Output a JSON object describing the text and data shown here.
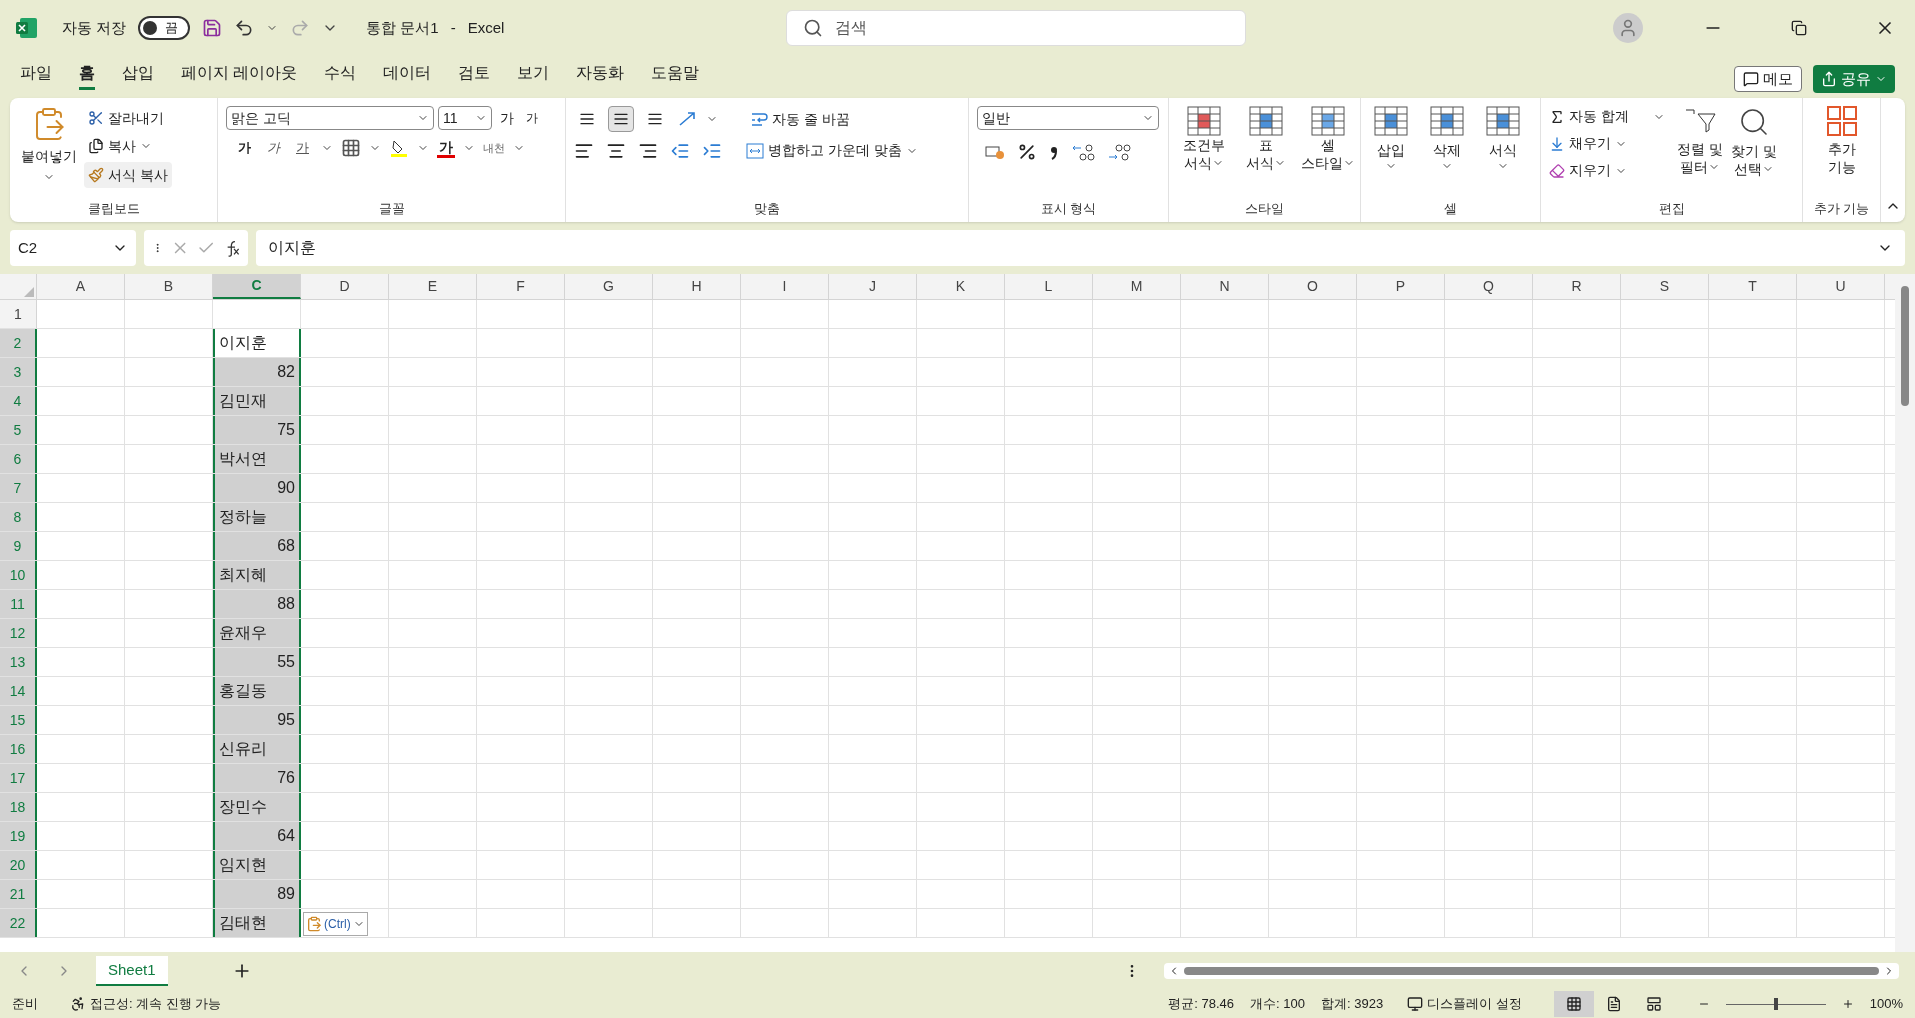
{
  "title_bar": {
    "autosave_label": "자동 저장",
    "autosave": {
      "label": "끔",
      "on": false
    },
    "document_title": "통합 문서1",
    "separator": "-",
    "app_name": "Excel",
    "search_placeholder": "검색"
  },
  "menu_tabs": [
    {
      "label": "파일",
      "selected": false
    },
    {
      "label": "홈",
      "selected": true
    },
    {
      "label": "삽입",
      "selected": false
    },
    {
      "label": "페이지 레이아웃",
      "selected": false
    },
    {
      "label": "수식",
      "selected": false
    },
    {
      "label": "데이터",
      "selected": false
    },
    {
      "label": "검토",
      "selected": false
    },
    {
      "label": "보기",
      "selected": false
    },
    {
      "label": "자동화",
      "selected": false
    },
    {
      "label": "도움말",
      "selected": false
    }
  ],
  "memo_button": "메모",
  "share_button": "공유",
  "ribbon": {
    "clipboard": {
      "label": "클립보드",
      "paste": "붙여넣기",
      "cut": "잘라내기",
      "copy": "복사",
      "format_painter": "서식 복사"
    },
    "font": {
      "label": "글꼴",
      "font_name": "맑은 고딕",
      "font_size": "11",
      "grow_font": "가",
      "shrink_font": "가",
      "bold": "가",
      "italic": "가",
      "underline": "가",
      "font_color": "가",
      "phonetic": "내천"
    },
    "alignment": {
      "label": "맞춤",
      "vertical_align": [
        {
          "selected": false
        },
        {
          "selected": true
        },
        {
          "selected": false
        }
      ],
      "wrap_text": "자동 줄 바꿈",
      "merge_center": "병합하고 가운데 맞춤"
    },
    "number": {
      "label": "표시 형식",
      "format": "일반"
    },
    "styles": {
      "label": "스타일",
      "items": [
        {
          "lines": [
            "조건부",
            "서식"
          ]
        },
        {
          "lines": [
            "표",
            "서식"
          ]
        },
        {
          "lines": [
            "셀",
            "스타일"
          ]
        }
      ]
    },
    "cells": {
      "label": "셀",
      "items": [
        "삽입",
        "삭제",
        "서식"
      ]
    },
    "editing": {
      "label": "편집",
      "autosum": "자동 합계",
      "fill": "채우기",
      "clear": "지우기",
      "sort_filter": [
        "정렬 및",
        "필터"
      ],
      "find_select": [
        "찾기 및",
        "선택"
      ]
    },
    "addins": {
      "label": "추가 기능",
      "button": [
        "추가",
        "기능"
      ]
    }
  },
  "formula_bar": {
    "name_box": "C2",
    "formula": "이지훈"
  },
  "columns": [
    {
      "label": "A",
      "selected": false
    },
    {
      "label": "B",
      "selected": false
    },
    {
      "label": "C",
      "selected": true
    },
    {
      "label": "D",
      "selected": false
    },
    {
      "label": "E",
      "selected": false
    },
    {
      "label": "F",
      "selected": false
    },
    {
      "label": "G",
      "selected": false
    },
    {
      "label": "H",
      "selected": false
    },
    {
      "label": "I",
      "selected": false
    },
    {
      "label": "J",
      "selected": false
    },
    {
      "label": "K",
      "selected": false
    },
    {
      "label": "L",
      "selected": false
    },
    {
      "label": "M",
      "selected": false
    },
    {
      "label": "N",
      "selected": false
    },
    {
      "label": "O",
      "selected": false
    },
    {
      "label": "P",
      "selected": false
    },
    {
      "label": "Q",
      "selected": false
    },
    {
      "label": "R",
      "selected": false
    },
    {
      "label": "S",
      "selected": false
    },
    {
      "label": "T",
      "selected": false
    },
    {
      "label": "U",
      "selected": false
    }
  ],
  "rows": [
    {
      "label": "1",
      "selected": false
    },
    {
      "label": "2",
      "selected": true,
      "active": true,
      "c": "이지훈",
      "kind": "text"
    },
    {
      "label": "3",
      "selected": true,
      "active": false,
      "c": "82",
      "kind": "number"
    },
    {
      "label": "4",
      "selected": true,
      "active": false,
      "c": "김민재",
      "kind": "text"
    },
    {
      "label": "5",
      "selected": true,
      "active": false,
      "c": "75",
      "kind": "number"
    },
    {
      "label": "6",
      "selected": true,
      "active": false,
      "c": "박서연",
      "kind": "text"
    },
    {
      "label": "7",
      "selected": true,
      "active": false,
      "c": "90",
      "kind": "number"
    },
    {
      "label": "8",
      "selected": true,
      "active": false,
      "c": "정하늘",
      "kind": "text"
    },
    {
      "label": "9",
      "selected": true,
      "active": false,
      "c": "68",
      "kind": "number"
    },
    {
      "label": "10",
      "selected": true,
      "active": false,
      "c": "최지혜",
      "kind": "text"
    },
    {
      "label": "11",
      "selected": true,
      "active": false,
      "c": "88",
      "kind": "number"
    },
    {
      "label": "12",
      "selected": true,
      "active": false,
      "c": "윤재우",
      "kind": "text"
    },
    {
      "label": "13",
      "selected": true,
      "active": false,
      "c": "55",
      "kind": "number"
    },
    {
      "label": "14",
      "selected": true,
      "active": false,
      "c": "홍길동",
      "kind": "text"
    },
    {
      "label": "15",
      "selected": true,
      "active": false,
      "c": "95",
      "kind": "number"
    },
    {
      "label": "16",
      "selected": true,
      "active": false,
      "c": "신유리",
      "kind": "text"
    },
    {
      "label": "17",
      "selected": true,
      "active": false,
      "c": "76",
      "kind": "number"
    },
    {
      "label": "18",
      "selected": true,
      "active": false,
      "c": "장민수",
      "kind": "text"
    },
    {
      "label": "19",
      "selected": true,
      "active": false,
      "c": "64",
      "kind": "number"
    },
    {
      "label": "20",
      "selected": true,
      "active": false,
      "c": "임지현",
      "kind": "text"
    },
    {
      "label": "21",
      "selected": true,
      "active": false,
      "c": "89",
      "kind": "number"
    },
    {
      "label": "22",
      "selected": true,
      "active": false,
      "c": "김태현",
      "kind": "text"
    }
  ],
  "paste_options": "(Ctrl)",
  "sheet_tabs": [
    {
      "label": "Sheet1",
      "selected": true
    }
  ],
  "status_bar": {
    "ready": "준비",
    "accessibility": "접근성: 계속 진행 가능",
    "average": "평균: 78.46",
    "count": "개수: 100",
    "sum": "합계: 3923",
    "display_settings": "디스플레이 설정",
    "views": [
      {
        "selected": true
      },
      {
        "selected": false
      },
      {
        "selected": false
      }
    ],
    "zoom": {
      "level": 0.5
    },
    "zoom_label": "100%"
  }
}
